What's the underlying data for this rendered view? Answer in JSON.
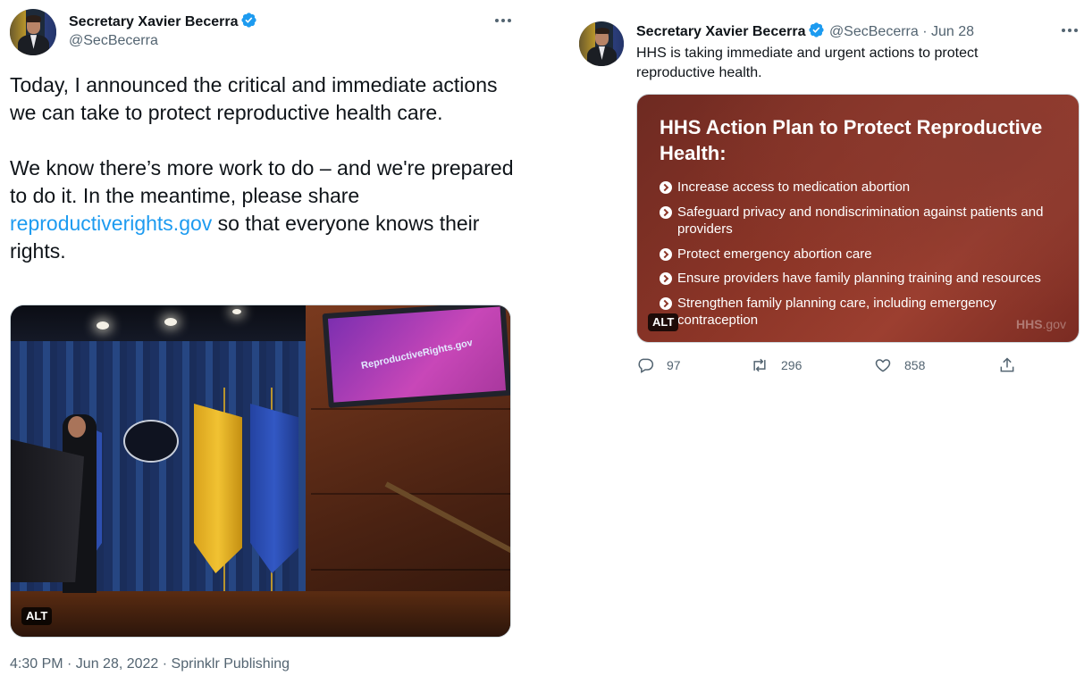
{
  "colors": {
    "accent_link": "#1d9bf0",
    "secondary_text": "#536471",
    "card_background": "#8c3527",
    "verified_badge": "#1d9bf0"
  },
  "left_tweet": {
    "author_name": "Secretary Xavier Becerra",
    "author_handle": "@SecBecerra",
    "text_part1": "Today, I announced the critical and immediate actions we can take to protect reproductive health care.\n\nWe know there’s more work to do – and we're prepared to do it. In the meantime, please share ",
    "link_text": "reproductiverights.gov",
    "text_part2": " so that everyone knows their rights.",
    "media": {
      "alt_badge": "ALT",
      "screen_text": "ReproductiveRights.gov"
    },
    "timestamp": "4:30 PM · Jun 28, 2022 · Sprinklr Publishing"
  },
  "right_tweet": {
    "author_name": "Secretary Xavier Becerra",
    "author_handle": "@SecBecerra",
    "date": "Jun 28",
    "text": "HHS is taking immediate and urgent actions to protect reproductive health.",
    "card": {
      "title": "HHS Action Plan to Protect Reproductive Health:",
      "items": [
        "Increase access to medication abortion",
        "Safeguard privacy and nondiscrimination against patients and providers",
        "Protect emergency abortion care",
        "Ensure providers have family planning training and resources",
        "Strengthen family planning care, including emergency contraception"
      ],
      "alt_badge": "ALT",
      "watermark_brand": "HHS",
      "watermark_domain": ".gov"
    },
    "actions": {
      "replies": "97",
      "retweets": "296",
      "likes": "858"
    }
  }
}
